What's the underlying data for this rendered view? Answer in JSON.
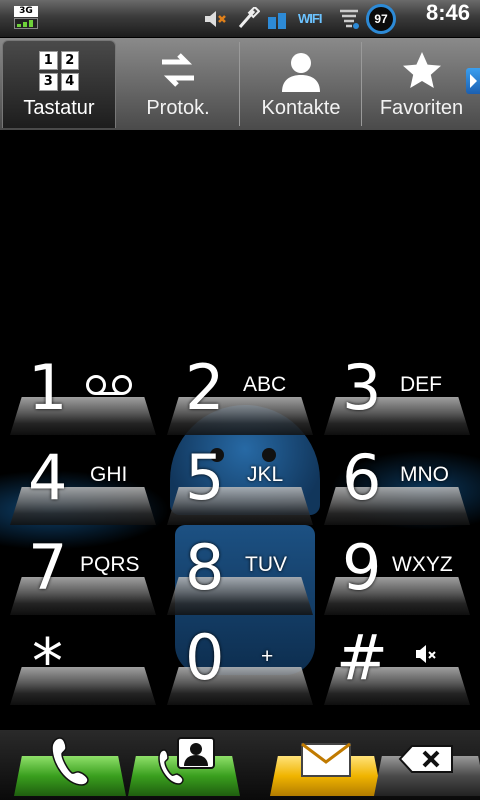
{
  "status_bar": {
    "network_label": "3G",
    "wifi_label": "WIFI",
    "battery_level": "97",
    "time": "8:46",
    "icons": [
      "3g-signal-icon",
      "mute-icon",
      "usb-icon",
      "wifi-icon",
      "data-sync-icon",
      "battery-icon"
    ]
  },
  "tabs": [
    {
      "id": "keypad",
      "label": "Tastatur",
      "icon": "dialpad-icon",
      "active": true,
      "icon_digits": [
        "1",
        "2",
        "3",
        "4"
      ]
    },
    {
      "id": "calllog",
      "label": "Protok.",
      "icon": "swap-arrows-icon",
      "active": false
    },
    {
      "id": "contacts",
      "label": "Kontakte",
      "icon": "person-icon",
      "active": false
    },
    {
      "id": "favorites",
      "label": "Favoriten",
      "icon": "star-icon",
      "active": false
    }
  ],
  "keys": [
    {
      "digit": "1",
      "letters": "",
      "icon": "voicemail-icon"
    },
    {
      "digit": "2",
      "letters": "ABC"
    },
    {
      "digit": "3",
      "letters": "DEF"
    },
    {
      "digit": "4",
      "letters": "GHI"
    },
    {
      "digit": "5",
      "letters": "JKL"
    },
    {
      "digit": "6",
      "letters": "MNO"
    },
    {
      "digit": "7",
      "letters": "PQRS"
    },
    {
      "digit": "8",
      "letters": "TUV"
    },
    {
      "digit": "9",
      "letters": "WXYZ"
    },
    {
      "digit": "*",
      "letters": ""
    },
    {
      "digit": "0",
      "letters": "+"
    },
    {
      "digit": "#",
      "letters": "",
      "icon": "mute-icon"
    }
  ],
  "actions": [
    {
      "id": "call",
      "icon": "phone-icon",
      "color": "#3a9f1e"
    },
    {
      "id": "add-contact",
      "icon": "contact-card-icon",
      "color": "#3a9f1e"
    },
    {
      "id": "message",
      "icon": "envelope-icon",
      "color": "#f0b400"
    },
    {
      "id": "delete",
      "icon": "backspace-icon",
      "color": "#4a4a4a"
    }
  ],
  "colors": {
    "accent_blue": "#2d8ad6",
    "call_green": "#3a9f1e",
    "message_yellow": "#f0b400"
  }
}
